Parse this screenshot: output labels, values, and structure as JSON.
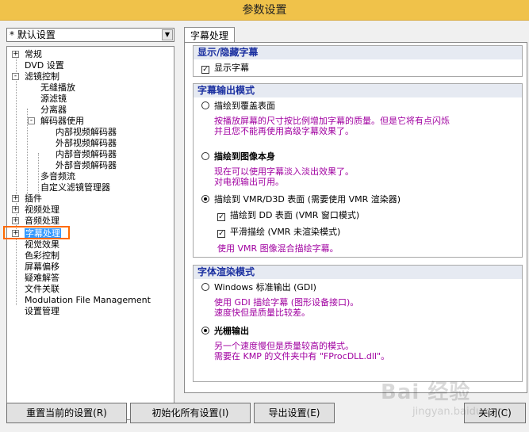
{
  "window": {
    "title": "参数设置"
  },
  "profile": {
    "value": "* 默认设置"
  },
  "tree": {
    "items": [
      {
        "label": "常规",
        "expander": "+"
      },
      {
        "label": "DVD 设置"
      },
      {
        "label": "滤镜控制",
        "expander": "-"
      },
      {
        "label": "无缝播放"
      },
      {
        "label": "源滤镜"
      },
      {
        "label": "分离器"
      },
      {
        "label": "解码器使用",
        "expander": "-"
      },
      {
        "label": "内部视频解码器"
      },
      {
        "label": "外部视频解码器"
      },
      {
        "label": "内部音频解码器"
      },
      {
        "label": "外部音频解码器"
      },
      {
        "label": "多音频流"
      },
      {
        "label": "自定义滤镜管理器"
      },
      {
        "label": "插件",
        "expander": "+"
      },
      {
        "label": "视频处理",
        "expander": "+"
      },
      {
        "label": "音频处理",
        "expander": "+"
      },
      {
        "label": "字幕处理",
        "expander": "+"
      },
      {
        "label": "视觉效果"
      },
      {
        "label": "色彩控制"
      },
      {
        "label": "屏幕偏移"
      },
      {
        "label": "疑难解答"
      },
      {
        "label": "文件关联"
      },
      {
        "label": "Modulation File Management"
      },
      {
        "label": "设置管理"
      }
    ]
  },
  "tab": {
    "label": "字幕处理"
  },
  "group_display": {
    "title": "显示/隐藏字幕",
    "show_subtitle": {
      "label": "显示字幕",
      "mark": "✓"
    }
  },
  "group_output": {
    "title": "字幕输出模式",
    "overlay": {
      "label": "描绘到覆盖表面",
      "desc1": "按播放屏幕的尺寸按比例增加字幕的质量。但是它将有点闪烁",
      "desc2": "并且您不能再使用高级字幕效果了。"
    },
    "image": {
      "label": "描绘到图像本身",
      "desc1": "现在可以使用字幕淡入淡出效果了。",
      "desc2": "对电视输出可用。"
    },
    "vmr": {
      "label": "描绘到 VMR/D3D 表面 (需要使用 VMR 渲染器)"
    },
    "dd_surface": {
      "label": "描绘到 DD 表面 (VMR 窗口模式)",
      "mark": "✓"
    },
    "smooth": {
      "label": "平滑描绘 (VMR 未渲染模式)",
      "mark": "✓"
    },
    "vmr_desc": "使用 VMR 图像混合描绘字幕。"
  },
  "group_render": {
    "title": "字体渲染模式",
    "gdi": {
      "label": "Windows 标准输出 (GDI)",
      "desc1": "使用 GDI 描绘字幕 (图形设备接口)。",
      "desc2": "速度快但是质量比较差。"
    },
    "raster": {
      "label": "光栅输出",
      "desc1": "另一个速度慢但是质量较高的模式。",
      "desc2": "需要在 KMP 的文件夹中有 \"FProcDLL.dll\"。"
    }
  },
  "buttons": {
    "reset": "重置当前的设置(R)",
    "init_all": "初始化所有设置(I)",
    "export": "导出设置(E)",
    "close": "关闭(C)"
  },
  "colors": {
    "accent_title": "#1a2fa0",
    "desc_purple": "#a000a0",
    "selection": "#3399ff",
    "titlebar": "#f0c24a"
  }
}
